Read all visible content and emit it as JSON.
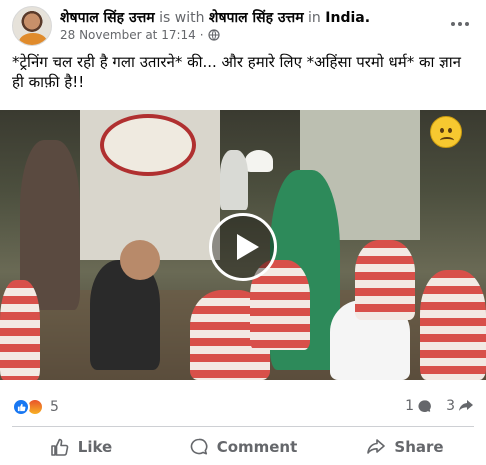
{
  "post": {
    "author": "शेषपाल सिंह उत्तम",
    "with_text": "is with",
    "tagged": "शेषपाल सिंह उत्तम",
    "in_text": "in",
    "location": "India.",
    "timestamp": "28 November at 17:14",
    "separator": "·",
    "text": "*ट्रेनिंग चल रही है गला उतारने*  की... और हमारे लिए *अहिंसा परमो धर्म* का ज्ञान ही काफ़ी है!!"
  },
  "stats": {
    "reactions_count": "5",
    "comments_count": "1",
    "shares_count": "3"
  },
  "actions": {
    "like": "Like",
    "comment": "Comment",
    "share": "Share"
  },
  "icons": [
    "globe-icon",
    "more-icon",
    "play-icon",
    "like-reaction-icon",
    "angry-reaction-icon",
    "comment-icon",
    "share-icon",
    "like-icon"
  ],
  "colors": {
    "accent": "#1877f2",
    "muted": "#65676b"
  }
}
